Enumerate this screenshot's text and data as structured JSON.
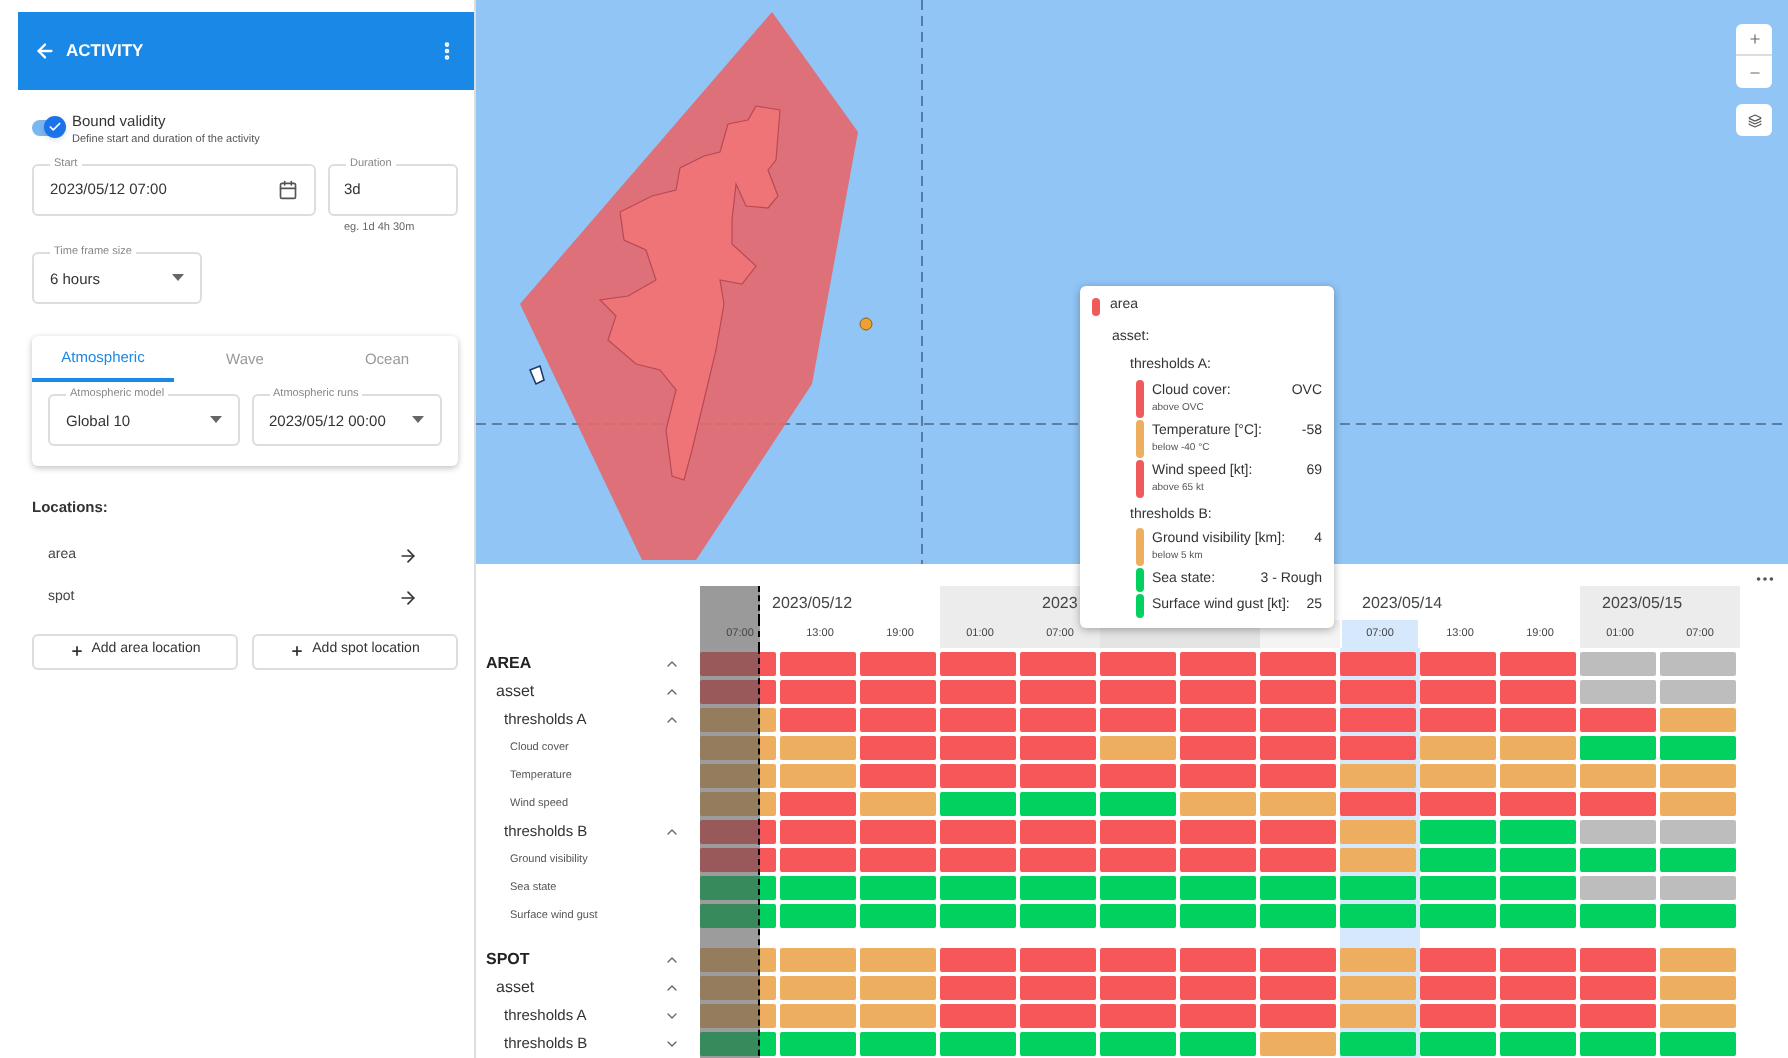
{
  "header": {
    "title": "ACTIVITY"
  },
  "bound_validity": {
    "label": "Bound validity",
    "description": "Define start and duration of the activity",
    "on": true
  },
  "start": {
    "label": "Start",
    "value": "2023/05/12 07:00"
  },
  "duration": {
    "label": "Duration",
    "value": "3d",
    "hint": "eg. 1d 4h 30m"
  },
  "time_frame": {
    "label": "Time frame size",
    "value": "6 hours"
  },
  "model_tabs": [
    {
      "label": "Atmospheric",
      "selected": true
    },
    {
      "label": "Wave",
      "selected": false
    },
    {
      "label": "Ocean",
      "selected": false
    }
  ],
  "model": {
    "label": "Atmospheric model",
    "value": "Global 10"
  },
  "runs": {
    "label": "Atmospheric runs",
    "value": "2023/05/12 00:00"
  },
  "locations": {
    "title": "Locations:",
    "items": [
      {
        "name": "area"
      },
      {
        "name": "spot"
      }
    ]
  },
  "buttons": [
    {
      "label": "Add area location"
    },
    {
      "label": "Add spot location"
    }
  ],
  "map_tooltip": {
    "title": "area",
    "color": "#f05a5a",
    "subtitle": "asset:",
    "sections": [
      {
        "label": "thresholds A:",
        "items": [
          {
            "label": "Cloud cover:",
            "value": "OVC",
            "note": "above OVC",
            "color": "#f05a5a"
          },
          {
            "label": "Temperature [°C]:",
            "value": "-58",
            "note": "below -40 °C",
            "color": "#eeae5f"
          },
          {
            "label": "Wind speed [kt]:",
            "value": "69",
            "note": "above 65 kt",
            "color": "#f05a5a"
          }
        ]
      },
      {
        "label": "thresholds B:",
        "items": [
          {
            "label": "Ground visibility [km]:",
            "value": "4",
            "note": "below 5 km",
            "color": "#eeae5f"
          },
          {
            "label": "Sea state:",
            "value": "3 - Rough",
            "color": "#00d15f"
          },
          {
            "label": "Surface wind gust [kt]:",
            "value": "25",
            "color": "#00d15f"
          }
        ]
      }
    ]
  },
  "timeline": {
    "days": [
      {
        "label": "2023/05/12",
        "shaded": false,
        "times": [
          {
            "label": "07:00",
            "highlighted": false,
            "level": 0.75
          },
          {
            "label": "13:00",
            "highlighted": false
          },
          {
            "label": "19:00",
            "highlighted": false
          }
        ]
      },
      {
        "label": "2023",
        "shaded": true,
        "times": [
          {
            "label": "01:00",
            "highlighted": false
          },
          {
            "label": "07:00",
            "highlighted": false
          },
          {
            "highlighted": false
          },
          {
            "highlighted": false
          }
        ]
      },
      {
        "label": "2023/05/14",
        "shaded": false,
        "times": [
          {
            "highlighted": false
          },
          {
            "label": "07:00",
            "highlighted": true
          },
          {
            "label": "13:00",
            "highlighted": false
          },
          {
            "label": "19:00",
            "highlighted": false
          }
        ]
      },
      {
        "label": "2023/05/15",
        "shaded": true,
        "times": [
          {
            "label": "01:00",
            "highlighted": false
          },
          {
            "label": "07:00",
            "highlighted": false
          }
        ]
      }
    ],
    "rows": [
      {
        "label": "AREA",
        "expanded": true,
        "cells": [
          {
            "color": "#f8575a"
          },
          {
            "color": "#f8575a"
          },
          {
            "color": "#f8575a"
          },
          {
            "color": "#f8575a"
          },
          {
            "color": "#f8575a"
          },
          {
            "color": "#f8575a"
          },
          {
            "color": "#f8575a"
          },
          {
            "color": "#f8575a"
          },
          {
            "color": "#f8575a"
          },
          {
            "color": "#f8575a"
          },
          {
            "color": "#f8575a"
          },
          {
            "color": "#bdbdbd"
          },
          {
            "color": "#bdbdbd"
          }
        ],
        "children": [
          {
            "label": "asset",
            "expanded": true,
            "cells": [
              {
                "color": "#f8575a"
              },
              {
                "color": "#f8575a"
              },
              {
                "color": "#f8575a"
              },
              {
                "color": "#f8575a"
              },
              {
                "color": "#f8575a"
              },
              {
                "color": "#f8575a"
              },
              {
                "color": "#f8575a"
              },
              {
                "color": "#f8575a"
              },
              {
                "color": "#f8575a"
              },
              {
                "color": "#f8575a"
              },
              {
                "color": "#f8575a"
              },
              {
                "color": "#bdbdbd"
              },
              {
                "color": "#bdbdbd"
              }
            ],
            "children": [
              {
                "label": "thresholds A",
                "expanded": true,
                "cells": [
                  {
                    "color": "#eeae5f"
                  },
                  {
                    "color": "#f8575a"
                  },
                  {
                    "color": "#f8575a"
                  },
                  {
                    "color": "#f8575a"
                  },
                  {
                    "color": "#f8575a"
                  },
                  {
                    "color": "#f8575a"
                  },
                  {
                    "color": "#f8575a"
                  },
                  {
                    "color": "#f8575a"
                  },
                  {
                    "color": "#f8575a"
                  },
                  {
                    "color": "#f8575a"
                  },
                  {
                    "color": "#f8575a"
                  },
                  {
                    "color": "#f8575a"
                  },
                  {
                    "color": "#eeae5f"
                  }
                ],
                "children": [
                  {
                    "label": "Cloud cover",
                    "cells": [
                      {
                        "color": "#eeae5f"
                      },
                      {
                        "color": "#eeae5f"
                      },
                      {
                        "color": "#f8575a"
                      },
                      {
                        "color": "#f8575a"
                      },
                      {
                        "color": "#f8575a"
                      },
                      {
                        "color": "#eeae5f"
                      },
                      {
                        "color": "#f8575a"
                      },
                      {
                        "color": "#f8575a"
                      },
                      {
                        "color": "#f8575a"
                      },
                      {
                        "color": "#eeae5f"
                      },
                      {
                        "color": "#eeae5f"
                      },
                      {
                        "color": "#00d15f"
                      },
                      {
                        "color": "#00d15f"
                      }
                    ]
                  },
                  {
                    "label": "Temperature",
                    "cells": [
                      {
                        "color": "#eeae5f"
                      },
                      {
                        "color": "#eeae5f"
                      },
                      {
                        "color": "#f8575a"
                      },
                      {
                        "color": "#f8575a"
                      },
                      {
                        "color": "#f8575a"
                      },
                      {
                        "color": "#f8575a"
                      },
                      {
                        "color": "#f8575a"
                      },
                      {
                        "color": "#f8575a"
                      },
                      {
                        "color": "#eeae5f"
                      },
                      {
                        "color": "#eeae5f"
                      },
                      {
                        "color": "#eeae5f"
                      },
                      {
                        "color": "#eeae5f"
                      },
                      {
                        "color": "#eeae5f"
                      }
                    ]
                  },
                  {
                    "label": "Wind speed",
                    "cells": [
                      {
                        "color": "#eeae5f"
                      },
                      {
                        "color": "#f8575a"
                      },
                      {
                        "color": "#eeae5f"
                      },
                      {
                        "color": "#00d15f"
                      },
                      {
                        "color": "#00d15f"
                      },
                      {
                        "color": "#00d15f"
                      },
                      {
                        "color": "#eeae5f"
                      },
                      {
                        "color": "#eeae5f"
                      },
                      {
                        "color": "#f8575a"
                      },
                      {
                        "color": "#f8575a"
                      },
                      {
                        "color": "#f8575a"
                      },
                      {
                        "color": "#f8575a"
                      },
                      {
                        "color": "#eeae5f"
                      }
                    ]
                  }
                ]
              },
              {
                "label": "thresholds B",
                "expanded": true,
                "cells": [
                  {
                    "color": "#f8575a"
                  },
                  {
                    "color": "#f8575a"
                  },
                  {
                    "color": "#f8575a"
                  },
                  {
                    "color": "#f8575a"
                  },
                  {
                    "color": "#f8575a"
                  },
                  {
                    "color": "#f8575a"
                  },
                  {
                    "color": "#f8575a"
                  },
                  {
                    "color": "#f8575a"
                  },
                  {
                    "color": "#eeae5f"
                  },
                  {
                    "color": "#00d15f"
                  },
                  {
                    "color": "#00d15f"
                  },
                  {
                    "color": "#bdbdbd"
                  },
                  {
                    "color": "#bdbdbd"
                  }
                ],
                "children": [
                  {
                    "label": "Ground visibility",
                    "cells": [
                      {
                        "color": "#f8575a"
                      },
                      {
                        "color": "#f8575a"
                      },
                      {
                        "color": "#f8575a"
                      },
                      {
                        "color": "#f8575a"
                      },
                      {
                        "color": "#f8575a"
                      },
                      {
                        "color": "#f8575a"
                      },
                      {
                        "color": "#f8575a"
                      },
                      {
                        "color": "#f8575a"
                      },
                      {
                        "color": "#eeae5f"
                      },
                      {
                        "color": "#00d15f"
                      },
                      {
                        "color": "#00d15f"
                      },
                      {
                        "color": "#00d15f"
                      },
                      {
                        "color": "#00d15f"
                      }
                    ]
                  },
                  {
                    "label": "Sea state",
                    "cells": [
                      {
                        "color": "#00d15f"
                      },
                      {
                        "color": "#00d15f"
                      },
                      {
                        "color": "#00d15f"
                      },
                      {
                        "color": "#00d15f"
                      },
                      {
                        "color": "#00d15f"
                      },
                      {
                        "color": "#00d15f"
                      },
                      {
                        "color": "#00d15f"
                      },
                      {
                        "color": "#00d15f"
                      },
                      {
                        "color": "#00d15f"
                      },
                      {
                        "color": "#00d15f"
                      },
                      {
                        "color": "#00d15f"
                      },
                      {
                        "color": "#bdbdbd"
                      },
                      {
                        "color": "#bdbdbd"
                      }
                    ]
                  },
                  {
                    "label": "Surface wind gust",
                    "cells": [
                      {
                        "color": "#00d15f"
                      },
                      {
                        "color": "#00d15f"
                      },
                      {
                        "color": "#00d15f"
                      },
                      {
                        "color": "#00d15f"
                      },
                      {
                        "color": "#00d15f"
                      },
                      {
                        "color": "#00d15f"
                      },
                      {
                        "color": "#00d15f"
                      },
                      {
                        "color": "#00d15f"
                      },
                      {
                        "color": "#00d15f"
                      },
                      {
                        "color": "#00d15f"
                      },
                      {
                        "color": "#00d15f"
                      },
                      {
                        "color": "#00d15f"
                      },
                      {
                        "color": "#00d15f"
                      }
                    ]
                  }
                ]
              }
            ]
          }
        ]
      },
      {
        "label": "SPOT",
        "expanded": true,
        "cells": [
          {
            "color": "#eeae5f"
          },
          {
            "color": "#eeae5f"
          },
          {
            "color": "#eeae5f"
          },
          {
            "color": "#f8575a"
          },
          {
            "color": "#f8575a"
          },
          {
            "color": "#f8575a"
          },
          {
            "color": "#f8575a"
          },
          {
            "color": "#f8575a"
          },
          {
            "color": "#eeae5f"
          },
          {
            "color": "#f8575a"
          },
          {
            "color": "#f8575a"
          },
          {
            "color": "#f8575a"
          },
          {
            "color": "#eeae5f"
          }
        ],
        "children": [
          {
            "label": "asset",
            "expanded": true,
            "cells": [
              {
                "color": "#eeae5f"
              },
              {
                "color": "#eeae5f"
              },
              {
                "color": "#eeae5f"
              },
              {
                "color": "#f8575a"
              },
              {
                "color": "#f8575a"
              },
              {
                "color": "#f8575a"
              },
              {
                "color": "#f8575a"
              },
              {
                "color": "#f8575a"
              },
              {
                "color": "#eeae5f"
              },
              {
                "color": "#f8575a"
              },
              {
                "color": "#f8575a"
              },
              {
                "color": "#f8575a"
              },
              {
                "color": "#eeae5f"
              }
            ],
            "children": [
              {
                "label": "thresholds A",
                "expanded": false,
                "cells": [
                  {
                    "color": "#eeae5f"
                  },
                  {
                    "color": "#eeae5f"
                  },
                  {
                    "color": "#eeae5f"
                  },
                  {
                    "color": "#f8575a"
                  },
                  {
                    "color": "#f8575a"
                  },
                  {
                    "color": "#f8575a"
                  },
                  {
                    "color": "#f8575a"
                  },
                  {
                    "color": "#f8575a"
                  },
                  {
                    "color": "#eeae5f"
                  },
                  {
                    "color": "#f8575a"
                  },
                  {
                    "color": "#f8575a"
                  },
                  {
                    "color": "#f8575a"
                  },
                  {
                    "color": "#eeae5f"
                  }
                ]
              },
              {
                "label": "thresholds B",
                "expanded": false,
                "cells": [
                  {
                    "color": "#00d15f"
                  },
                  {
                    "color": "#00d15f"
                  },
                  {
                    "color": "#00d15f"
                  },
                  {
                    "color": "#00d15f"
                  },
                  {
                    "color": "#00d15f"
                  },
                  {
                    "color": "#00d15f"
                  },
                  {
                    "color": "#00d15f"
                  },
                  {
                    "color": "#eeae5f"
                  },
                  {
                    "color": "#00d15f"
                  },
                  {
                    "color": "#00d15f"
                  },
                  {
                    "color": "#00d15f"
                  },
                  {
                    "color": "#00d15f"
                  },
                  {
                    "color": "#00d15f"
                  }
                ]
              }
            ]
          }
        ]
      }
    ]
  }
}
